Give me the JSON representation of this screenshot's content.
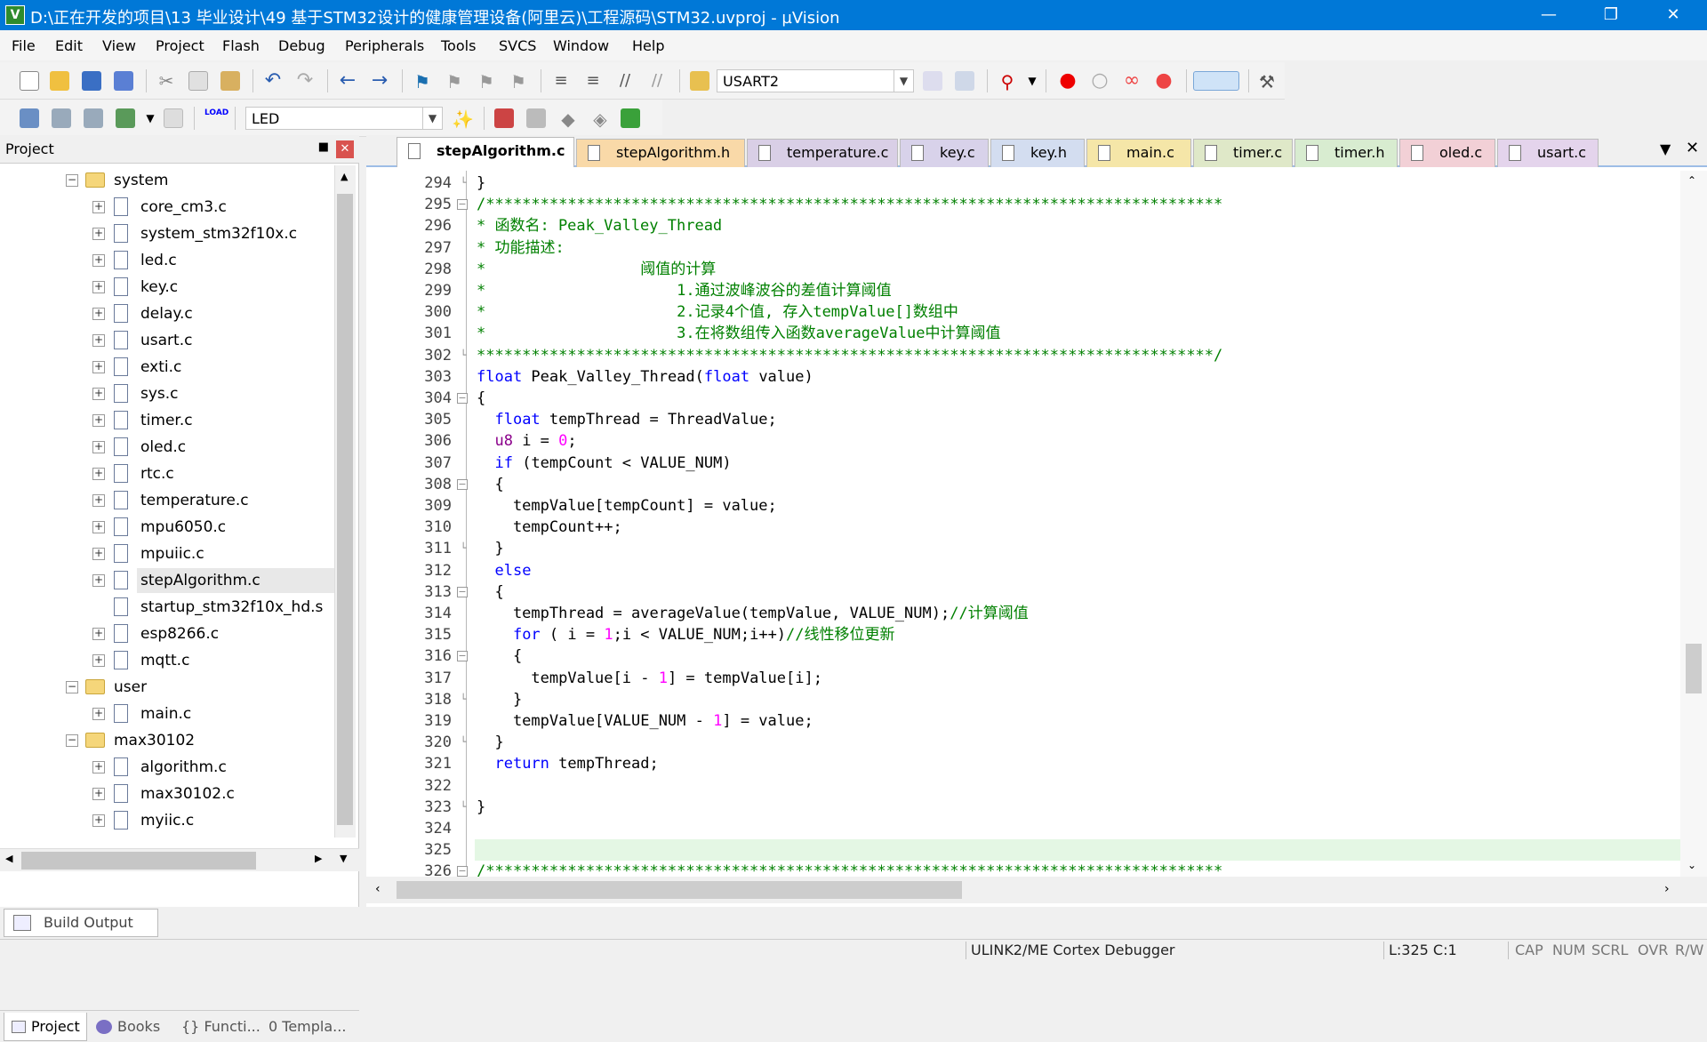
{
  "window": {
    "title": "D:\\正在开发的项目\\13 毕业设计\\49 基于STM32设计的健康管理设备(阿里云)\\工程源码\\STM32.uvproj - µVision"
  },
  "menu": [
    "File",
    "Edit",
    "View",
    "Project",
    "Flash",
    "Debug",
    "Peripherals",
    "Tools",
    "SVCS",
    "Window",
    "Help"
  ],
  "toolbar1": {
    "combo_value": "USART2"
  },
  "toolbar2": {
    "load_label": "LOAD",
    "combo_value": "LED"
  },
  "project_panel": {
    "title": "Project",
    "tree": [
      {
        "label": "system",
        "type": "folder",
        "level": 0,
        "expanded": true
      },
      {
        "label": "core_cm3.c",
        "type": "file",
        "level": 1
      },
      {
        "label": "system_stm32f10x.c",
        "type": "file",
        "level": 1
      },
      {
        "label": "led.c",
        "type": "file",
        "level": 1
      },
      {
        "label": "key.c",
        "type": "file",
        "level": 1
      },
      {
        "label": "delay.c",
        "type": "file",
        "level": 1
      },
      {
        "label": "usart.c",
        "type": "file",
        "level": 1
      },
      {
        "label": "exti.c",
        "type": "file",
        "level": 1
      },
      {
        "label": "sys.c",
        "type": "file",
        "level": 1
      },
      {
        "label": "timer.c",
        "type": "file",
        "level": 1
      },
      {
        "label": "oled.c",
        "type": "file",
        "level": 1
      },
      {
        "label": "rtc.c",
        "type": "file",
        "level": 1
      },
      {
        "label": "temperature.c",
        "type": "file",
        "level": 1
      },
      {
        "label": "mpu6050.c",
        "type": "file",
        "level": 1
      },
      {
        "label": "mpuiic.c",
        "type": "file",
        "level": 1
      },
      {
        "label": "stepAlgorithm.c",
        "type": "file",
        "level": 1,
        "selected": true
      },
      {
        "label": "startup_stm32f10x_hd.s",
        "type": "file",
        "level": 1,
        "no_expander": true
      },
      {
        "label": "esp8266.c",
        "type": "file",
        "level": 1
      },
      {
        "label": "mqtt.c",
        "type": "file",
        "level": 1
      },
      {
        "label": "user",
        "type": "folder",
        "level": 0,
        "expanded": true
      },
      {
        "label": "main.c",
        "type": "file",
        "level": 1
      },
      {
        "label": "max30102",
        "type": "folder",
        "level": 0,
        "expanded": true
      },
      {
        "label": "algorithm.c",
        "type": "file",
        "level": 1
      },
      {
        "label": "max30102.c",
        "type": "file",
        "level": 1
      },
      {
        "label": "myiic.c",
        "type": "file",
        "level": 1
      }
    ],
    "bottom_tabs": [
      "Project",
      "Books",
      "Functi...",
      "Templa..."
    ]
  },
  "editor": {
    "tabs": [
      {
        "label": "stepAlgorithm.c",
        "active": true,
        "color": "#f2f2f2"
      },
      {
        "label": "stepAlgorithm.h",
        "color": "#f9d9a8"
      },
      {
        "label": "temperature.c",
        "color": "#d9cfe6"
      },
      {
        "label": "key.c",
        "color": "#d8d2ea"
      },
      {
        "label": "key.h",
        "color": "#d3ddf0"
      },
      {
        "label": "main.c",
        "color": "#f5e6a8"
      },
      {
        "label": "timer.c",
        "color": "#dfe8c8"
      },
      {
        "label": "timer.h",
        "color": "#d8ecd0"
      },
      {
        "label": "oled.c",
        "color": "#f2d0d6"
      },
      {
        "label": "usart.c",
        "color": "#e4d4ec"
      }
    ],
    "current_line": 325,
    "lines": [
      {
        "n": "294",
        "fold": "end",
        "segs": [
          {
            "t": "}",
            "c": "#000"
          }
        ]
      },
      {
        "n": "295",
        "fold": "box",
        "segs": [
          {
            "t": "/*********************************************************************************",
            "c": "#008000"
          }
        ]
      },
      {
        "n": "296",
        "fold": "line",
        "segs": [
          {
            "t": "* 函数名: Peak_Valley_Thread",
            "c": "#008000"
          }
        ]
      },
      {
        "n": "297",
        "fold": "line",
        "segs": [
          {
            "t": "* 功能描述:",
            "c": "#008000"
          }
        ]
      },
      {
        "n": "298",
        "fold": "line",
        "segs": [
          {
            "t": "*                 阈值的计算",
            "c": "#008000"
          }
        ]
      },
      {
        "n": "299",
        "fold": "line",
        "segs": [
          {
            "t": "*                     1.通过波峰波谷的差值计算阈值",
            "c": "#008000"
          }
        ]
      },
      {
        "n": "300",
        "fold": "line",
        "segs": [
          {
            "t": "*                     2.记录4个值, 存入tempValue[]数组中",
            "c": "#008000"
          }
        ]
      },
      {
        "n": "301",
        "fold": "line",
        "segs": [
          {
            "t": "*                     3.在将数组传入函数averageValue中计算阈值",
            "c": "#008000"
          }
        ]
      },
      {
        "n": "302",
        "fold": "end",
        "segs": [
          {
            "t": "*********************************************************************************/",
            "c": "#008000"
          }
        ]
      },
      {
        "n": "303",
        "fold": "",
        "segs": [
          {
            "t": "float",
            "c": "#0000ff"
          },
          {
            "t": " Peak_Valley_Thread(",
            "c": "#000"
          },
          {
            "t": "float",
            "c": "#0000ff"
          },
          {
            "t": " value)",
            "c": "#000"
          }
        ]
      },
      {
        "n": "304",
        "fold": "box",
        "segs": [
          {
            "t": "{",
            "c": "#000"
          }
        ]
      },
      {
        "n": "305",
        "fold": "line",
        "segs": [
          {
            "t": "  ",
            "c": "#000"
          },
          {
            "t": "float",
            "c": "#0000ff"
          },
          {
            "t": " tempThread = ThreadValue;",
            "c": "#000"
          }
        ]
      },
      {
        "n": "306",
        "fold": "line",
        "segs": [
          {
            "t": "  ",
            "c": "#000"
          },
          {
            "t": "u8",
            "c": "#8b008b"
          },
          {
            "t": " i = ",
            "c": "#000"
          },
          {
            "t": "0",
            "c": "#ff00ff"
          },
          {
            "t": ";",
            "c": "#000"
          }
        ]
      },
      {
        "n": "307",
        "fold": "line",
        "segs": [
          {
            "t": "  ",
            "c": "#000"
          },
          {
            "t": "if",
            "c": "#0000ff"
          },
          {
            "t": " (tempCount < VALUE_NUM)",
            "c": "#000"
          }
        ]
      },
      {
        "n": "308",
        "fold": "box",
        "segs": [
          {
            "t": "  {",
            "c": "#000"
          }
        ]
      },
      {
        "n": "309",
        "fold": "line",
        "segs": [
          {
            "t": "    tempValue[tempCount] = value;",
            "c": "#000"
          }
        ]
      },
      {
        "n": "310",
        "fold": "line",
        "segs": [
          {
            "t": "    tempCount++;",
            "c": "#000"
          }
        ]
      },
      {
        "n": "311",
        "fold": "end",
        "segs": [
          {
            "t": "  }",
            "c": "#000"
          }
        ]
      },
      {
        "n": "312",
        "fold": "line",
        "segs": [
          {
            "t": "  ",
            "c": "#000"
          },
          {
            "t": "else",
            "c": "#0000ff"
          }
        ]
      },
      {
        "n": "313",
        "fold": "box",
        "segs": [
          {
            "t": "  {",
            "c": "#000"
          }
        ]
      },
      {
        "n": "314",
        "fold": "line",
        "segs": [
          {
            "t": "    tempThread = averageValue(tempValue, VALUE_NUM);",
            "c": "#000"
          },
          {
            "t": "//计算阈值",
            "c": "#008000"
          }
        ]
      },
      {
        "n": "315",
        "fold": "line",
        "segs": [
          {
            "t": "    ",
            "c": "#000"
          },
          {
            "t": "for",
            "c": "#0000ff"
          },
          {
            "t": " ( i = ",
            "c": "#000"
          },
          {
            "t": "1",
            "c": "#ff00ff"
          },
          {
            "t": ";i < VALUE_NUM;i++)",
            "c": "#000"
          },
          {
            "t": "//线性移位更新",
            "c": "#008000"
          }
        ]
      },
      {
        "n": "316",
        "fold": "box",
        "segs": [
          {
            "t": "    {",
            "c": "#000"
          }
        ]
      },
      {
        "n": "317",
        "fold": "line",
        "segs": [
          {
            "t": "      tempValue[i - ",
            "c": "#000"
          },
          {
            "t": "1",
            "c": "#ff00ff"
          },
          {
            "t": "] = tempValue[i];",
            "c": "#000"
          }
        ]
      },
      {
        "n": "318",
        "fold": "end",
        "segs": [
          {
            "t": "    }",
            "c": "#000"
          }
        ]
      },
      {
        "n": "319",
        "fold": "line",
        "segs": [
          {
            "t": "    tempValue[VALUE_NUM - ",
            "c": "#000"
          },
          {
            "t": "1",
            "c": "#ff00ff"
          },
          {
            "t": "] = value;",
            "c": "#000"
          }
        ]
      },
      {
        "n": "320",
        "fold": "end",
        "segs": [
          {
            "t": "  }",
            "c": "#000"
          }
        ]
      },
      {
        "n": "321",
        "fold": "line",
        "segs": [
          {
            "t": "  ",
            "c": "#000"
          },
          {
            "t": "return",
            "c": "#0000ff"
          },
          {
            "t": " tempThread;",
            "c": "#000"
          }
        ]
      },
      {
        "n": "322",
        "fold": "line",
        "segs": []
      },
      {
        "n": "323",
        "fold": "end",
        "segs": [
          {
            "t": "}",
            "c": "#000"
          }
        ]
      },
      {
        "n": "324",
        "fold": "",
        "segs": []
      },
      {
        "n": "325",
        "fold": "",
        "segs": []
      },
      {
        "n": "326",
        "fold": "box",
        "segs": [
          {
            "t": "/*********************************************************************************",
            "c": "#008000"
          }
        ]
      }
    ]
  },
  "build_output": {
    "label": "Build Output"
  },
  "status": {
    "debugger": "ULINK2/ME Cortex Debugger",
    "position": "L:325 C:1",
    "flags": [
      "CAP",
      "NUM",
      "SCRL",
      "OVR",
      "R/W"
    ]
  }
}
